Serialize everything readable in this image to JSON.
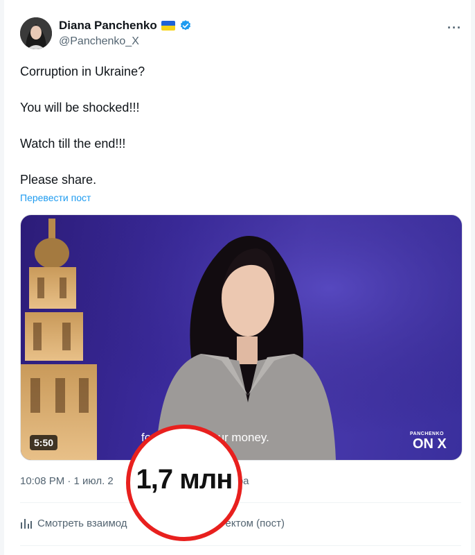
{
  "author": {
    "name": "Diana Panchenko",
    "handle": "@Panchenko_X"
  },
  "tweet": {
    "paragraphs": [
      "Corruption in Ukraine?",
      "You will be shocked!!!",
      "Watch till the end!!!",
      "Please share."
    ],
    "translate_label": "Перевести пост"
  },
  "video": {
    "duration": "5:50",
    "subtitle": "fo           ction, not your money.",
    "logo_small": "PANCHENKO",
    "logo_large": "ON X"
  },
  "meta": {
    "time_date": "10:08 PM · 1 июл. 2",
    "views_suffix": "отра"
  },
  "highlight": {
    "views": "1,7 млн",
    "color": "#e8201e"
  },
  "analytics": {
    "label_left": "Смотреть взаимод",
    "label_right": "ектом (пост)"
  },
  "colors": {
    "link": "#1d9bf0",
    "muted": "#536471",
    "verified": "#1d9bf0"
  }
}
